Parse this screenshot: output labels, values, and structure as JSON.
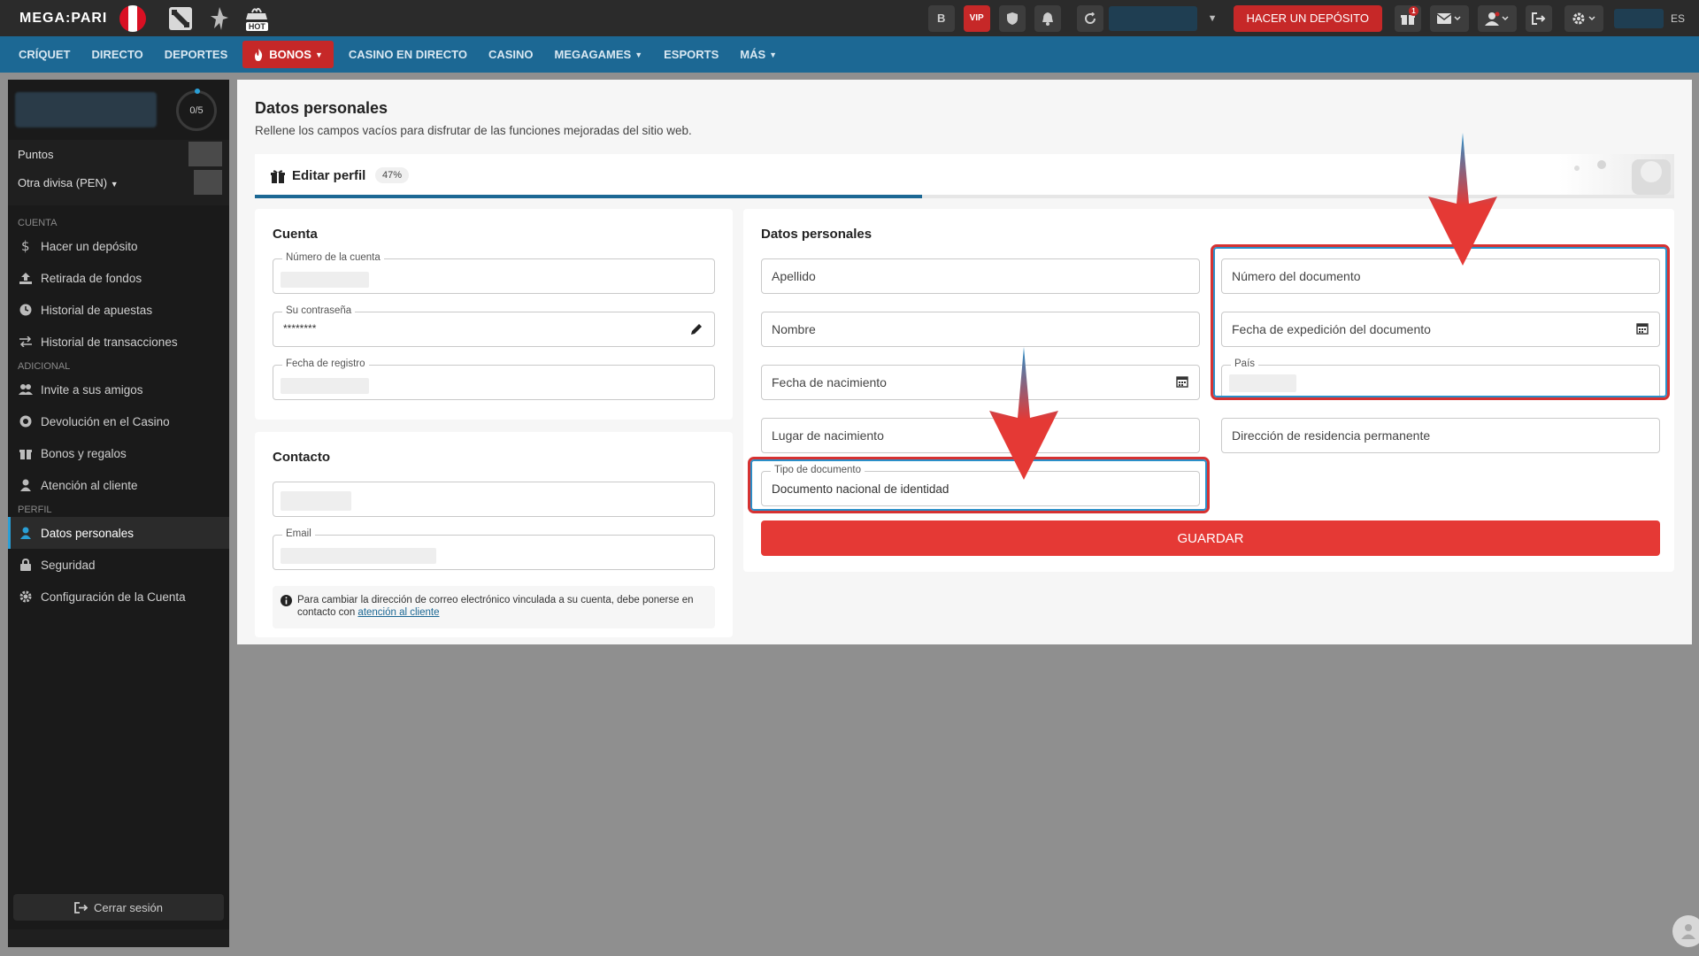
{
  "header": {
    "logo_text": "MEGA:PARI",
    "hot_label": "HOT",
    "vip_label": "VIP",
    "btc_label": "B",
    "deposit_label": "HACER UN DEPÓSITO",
    "gift_badge": "1",
    "language": "ES"
  },
  "nav": {
    "items": [
      "CRÍQUET",
      "DIRECTO",
      "DEPORTES",
      "BONOS",
      "CASINO EN DIRECTO",
      "CASINO",
      "MEGAGAMES",
      "ESPORTS",
      "MÁS"
    ],
    "active": "BONOS"
  },
  "sidebar": {
    "progress": "0/5",
    "points_label": "Puntos",
    "currency_label": "Otra divisa (PEN)",
    "section_account": "CUENTA",
    "section_additional": "ADICIONAL",
    "section_profile": "PERFIL",
    "account_items": [
      "Hacer un depósito",
      "Retirada de fondos",
      "Historial de apuestas",
      "Historial de transacciones"
    ],
    "additional_items": [
      "Invite a sus amigos",
      "Devolución en el Casino",
      "Bonos y regalos",
      "Atención al cliente"
    ],
    "profile_items": [
      "Datos personales",
      "Seguridad",
      "Configuración de la Cuenta"
    ],
    "logout_label": "Cerrar sesión"
  },
  "page": {
    "title": "Datos personales",
    "subtitle": "Rellene los campos vacíos para disfrutar de las funciones mejoradas del sitio web.",
    "edit_profile_label": "Editar perfil",
    "completion": 0.47,
    "completion_label": "47%"
  },
  "account_card": {
    "title": "Cuenta",
    "account_number_label": "Número de la cuenta",
    "password_label": "Su contraseña",
    "password_value": "********",
    "registration_date_label": "Fecha de registro"
  },
  "contact_card": {
    "title": "Contacto",
    "email_label": "Email",
    "note_text": "Para cambiar la dirección de correo electrónico vinculada a su cuenta, debe ponerse en contacto con",
    "note_link": "atención al cliente"
  },
  "personal_card": {
    "title": "Datos personales",
    "surname_placeholder": "Apellido",
    "name_placeholder": "Nombre",
    "birthdate_placeholder": "Fecha de nacimiento",
    "birthplace_placeholder": "Lugar de nacimiento",
    "doc_type_label": "Tipo de documento",
    "doc_type_value": "Documento nacional de identidad",
    "doc_number_placeholder": "Número del documento",
    "doc_issue_date_placeholder": "Fecha de expedición del documento",
    "country_label": "País",
    "address_placeholder": "Dirección de residencia permanente",
    "save_label": "GUARDAR"
  },
  "colors": {
    "topbar": "#2b2b2b",
    "navbar": "#1c6894",
    "accent_red": "#e53935",
    "sidebar": "#1f1f1f",
    "highlight_red": "#d63232",
    "highlight_blue": "#2a8fc9"
  }
}
